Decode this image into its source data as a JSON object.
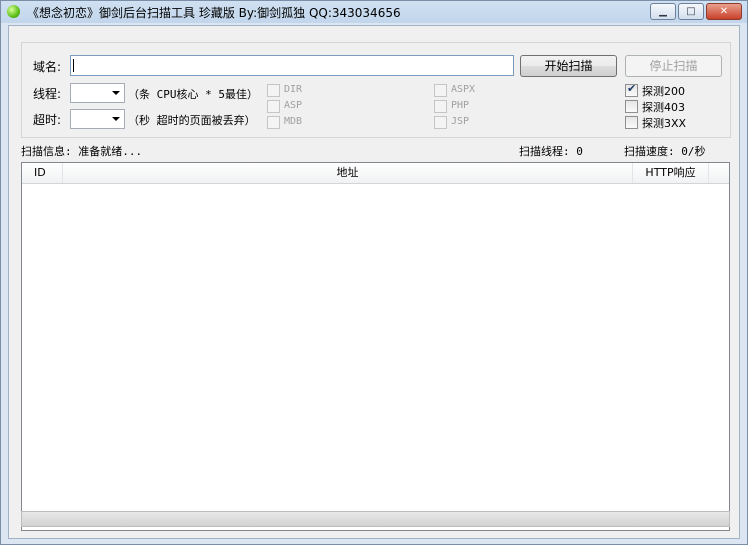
{
  "window": {
    "title": "《想念初恋》御剑后台扫描工具 珍藏版 By:御剑孤独 QQ:343034656",
    "icon": "green-orb-icon",
    "minimize_label": "▁",
    "maximize_label": "□",
    "close_label": "✕"
  },
  "form": {
    "domain_label": "域名:",
    "domain_value": "",
    "threads_label": "线程:",
    "threads_value": "",
    "threads_hint": "（条 CPU核心 * 5最佳）",
    "timeout_label": "超时:",
    "timeout_value": "",
    "timeout_hint": "（秒 超时的页面被丢弃）",
    "start_button": "开始扫描",
    "stop_button": "停止扫描",
    "scan_types": [
      {
        "label": "DIR",
        "checked": false,
        "enabled": false
      },
      {
        "label": "ASP",
        "checked": false,
        "enabled": false
      },
      {
        "label": "MDB",
        "checked": false,
        "enabled": false
      },
      {
        "label": "ASPX",
        "checked": false,
        "enabled": false
      },
      {
        "label": "PHP",
        "checked": false,
        "enabled": false
      },
      {
        "label": "JSP",
        "checked": false,
        "enabled": false
      }
    ],
    "probes": [
      {
        "label": "探测200",
        "checked": true
      },
      {
        "label": "探测403",
        "checked": false
      },
      {
        "label": "探测3XX",
        "checked": false
      }
    ]
  },
  "info": {
    "scan_info": "扫描信息: 准备就绪...",
    "scan_threads": "扫描线程: 0",
    "scan_speed": "扫描速度: 0/秒"
  },
  "table": {
    "columns": [
      "ID",
      "地址",
      "HTTP响应"
    ],
    "rows": []
  },
  "colors": {
    "title_gradient": "#c2d6ec",
    "client_bg": "#f0f0f0"
  }
}
